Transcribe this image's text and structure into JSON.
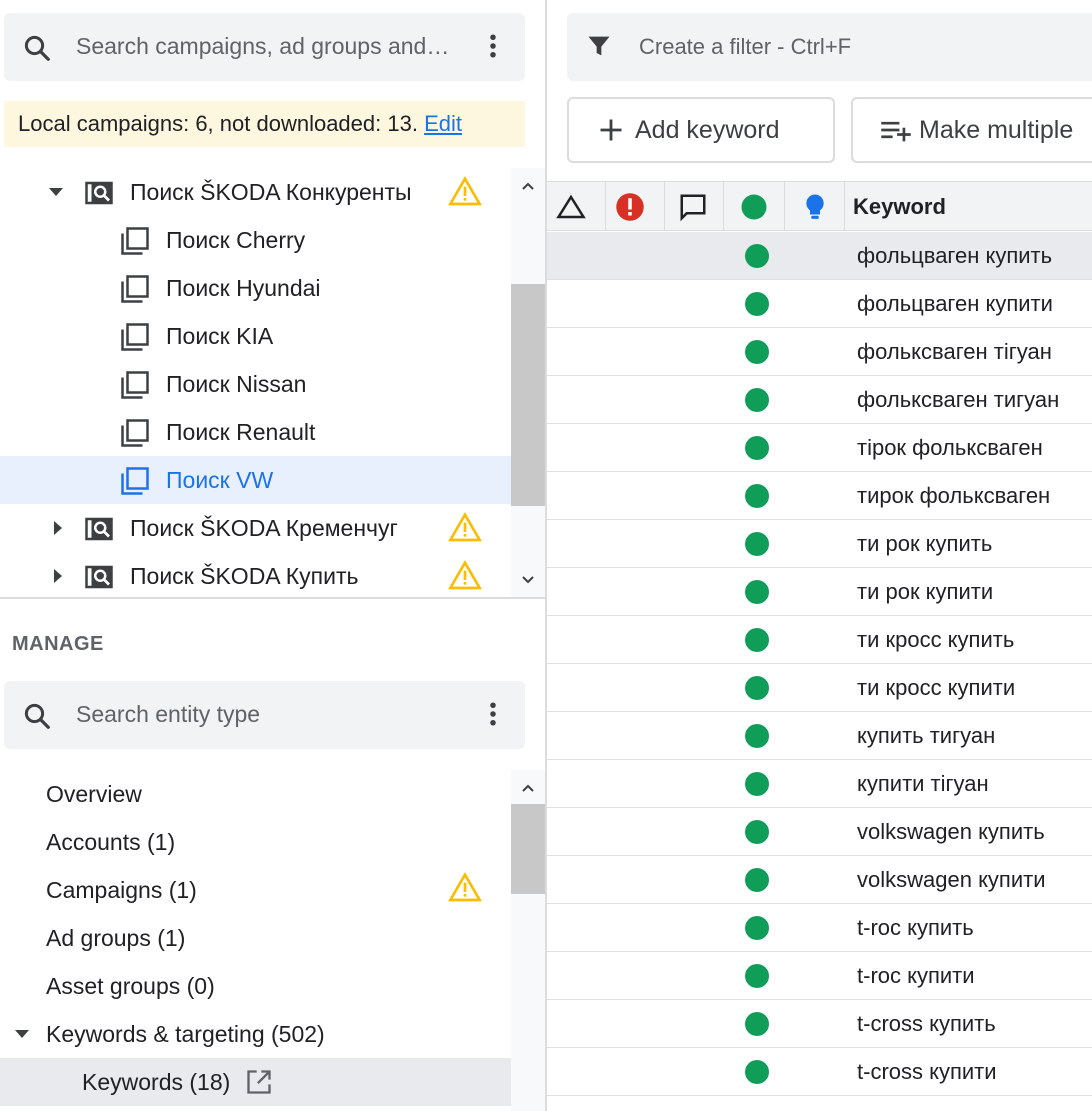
{
  "left_panel": {
    "search": {
      "placeholder": "Search campaigns, ad groups and…"
    },
    "banner": {
      "text": "Local campaigns: 6, not downloaded: 13. ",
      "edit_link": "Edit"
    },
    "tree": [
      {
        "label": "Поиск ŠKODA Конкуренты",
        "type": "campaign",
        "expanded": true,
        "warning": true
      },
      {
        "label": "Поиск Cherry",
        "type": "ad-group"
      },
      {
        "label": "Поиск Hyundai",
        "type": "ad-group"
      },
      {
        "label": "Поиск KIA",
        "type": "ad-group"
      },
      {
        "label": "Поиск Nissan",
        "type": "ad-group"
      },
      {
        "label": "Поиск Renault",
        "type": "ad-group"
      },
      {
        "label": "Поиск VW",
        "type": "ad-group",
        "selected": true
      },
      {
        "label": "Поиск ŠKODA Кременчуг",
        "type": "campaign",
        "expanded": false,
        "warning": true
      },
      {
        "label": "Поиск ŠKODA Купить",
        "type": "campaign",
        "expanded": false,
        "warning": true
      }
    ],
    "manage": {
      "heading": "MANAGE",
      "search": {
        "placeholder": "Search entity type"
      },
      "items": [
        {
          "label": "Overview"
        },
        {
          "label": "Accounts (1)"
        },
        {
          "label": "Campaigns (1)",
          "warning": true
        },
        {
          "label": "Ad groups (1)"
        },
        {
          "label": "Asset groups (0)"
        },
        {
          "label": "Keywords & targeting (502)",
          "expanded": true
        },
        {
          "label": "Keywords (18)",
          "selected": true,
          "sub": true,
          "open_icon": "open-in-new-icon"
        }
      ]
    }
  },
  "right_panel": {
    "filter": {
      "placeholder": "Create a filter - Ctrl+F"
    },
    "buttons": {
      "add_keyword": "Add keyword",
      "make_multiple": "Make multiple"
    },
    "table": {
      "header_icons": [
        "change-triangle-icon",
        "error-icon",
        "comment-icon",
        "status-dot-icon",
        "lightbulb-icon"
      ],
      "keyword_header": "Keyword",
      "rows": [
        "фольцваген купить",
        "фольцваген купити",
        "фольксваген тігуан",
        "фольксваген тигуан",
        "тірок фольксваген",
        "тирок фольксваген",
        "ти рок купить",
        "ти рок купити",
        "ти кросс купить",
        "ти кросс купити",
        "купить тигуан",
        "купити тігуан",
        "volkswagen купить",
        "volkswagen купити",
        "t-roc купить",
        "t-roc купити",
        "t-cross купить",
        "t-cross купити"
      ]
    }
  },
  "colors": {
    "accent": "#1a73e8",
    "status_green": "#0f9d58",
    "warning_yellow": "#fbbc04",
    "error_red": "#d93025",
    "banner_bg": "#fef7e0",
    "selected_bg": "#e8f0fe"
  }
}
